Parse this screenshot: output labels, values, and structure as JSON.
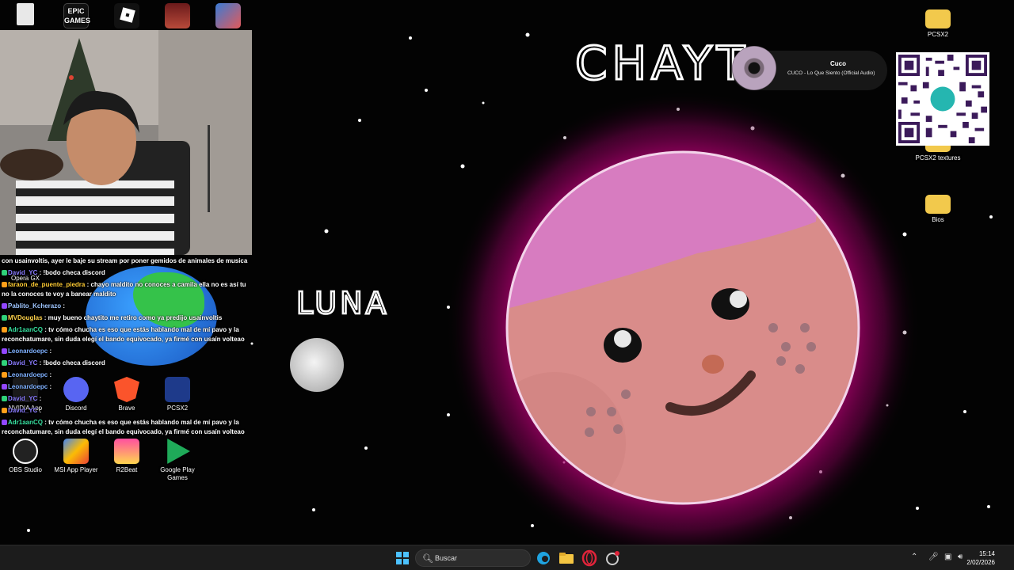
{
  "wallpaper": {
    "title_text": "CHAYT",
    "luna_text": "LUNA"
  },
  "desktop": {
    "top_icons": [
      {
        "name": "recycle-bin-icon",
        "label": ""
      },
      {
        "name": "epic-games-icon",
        "label": "EPIC GAMES"
      },
      {
        "name": "roblox-icon",
        "label": ""
      },
      {
        "name": "game-shortcut-1-icon",
        "label": ""
      },
      {
        "name": "game-shortcut-2-icon",
        "label": ""
      }
    ],
    "right_icons": [
      {
        "name": "folder-pcsx2",
        "label": "PCSX2"
      },
      {
        "name": "folder-pcsx2-textures",
        "label": "PCSX2 textures"
      },
      {
        "name": "folder-bios",
        "label": "Bios"
      }
    ],
    "left_icons_row1": [
      {
        "label": "Discord"
      },
      {
        "label": "Brave"
      },
      {
        "label": "PCSX2"
      }
    ],
    "left_icons_row2": [
      {
        "label": "OBS Studio"
      },
      {
        "label": "MSI App Player"
      },
      {
        "label": "R2Beat"
      },
      {
        "label": "Google Play Games"
      }
    ],
    "partial_labels": {
      "opera_gx": "Opera GX",
      "nvidia_app": "NVIDIA App"
    }
  },
  "chat": {
    "lines": [
      {
        "user": "",
        "user_color": "#ffffff",
        "text": "con usainvoltis, ayer le baje su stream por poner gemidos de animales de musica"
      },
      {
        "user": "David_YC",
        "user_color": "#8a7cff",
        "text": ": !bodo checa discord"
      },
      {
        "user": "faraon_de_puente_piedra",
        "user_color": "#ffcc33",
        "text": ": chayo maldito no conoces a camila ella no es así tu no la conoces te voy a banear maldito"
      },
      {
        "user": "Pablito_Kcherazo",
        "user_color": "#9fc6ff",
        "text": ":"
      },
      {
        "user": "MVDouglas",
        "user_color": "#ffd24a",
        "text": ": muy bueno chaytito me retiro como ya predijo usainvoltis"
      },
      {
        "user": "Adr1aanCQ",
        "user_color": "#37e0a0",
        "text": ": tv cómo chucha es eso que estás hablando mal de mí pavo y la reconchatumare, sin duda elegí el bando equivocado, ya firmé con usaín volteao"
      },
      {
        "user": "Leonardoepc",
        "user_color": "#7fb1ff",
        "text": ":"
      },
      {
        "user": "David_YC",
        "user_color": "#8a7cff",
        "text": ": !bodo checa discord"
      },
      {
        "user": "Leonardoepc",
        "user_color": "#7fb1ff",
        "text": ":"
      },
      {
        "user": "Leonardoepc",
        "user_color": "#7fb1ff",
        "text": ":"
      },
      {
        "user": "David_YC",
        "user_color": "#8a7cff",
        "text": ":"
      },
      {
        "user": "David_YC",
        "user_color": "#8a7cff",
        "text": ":"
      },
      {
        "user": "Adr1aanCQ",
        "user_color": "#37e0a0",
        "text": ": tv cómo chucha es eso que estás hablando mal de mí pavo y la reconchatumare, sin duda elegí el bando equivocado, ya firmé con usaín volteao"
      }
    ]
  },
  "music": {
    "artist": "Cuco",
    "track": "CUCO - Lo Que Siento (Official Audio)"
  },
  "taskbar": {
    "search_placeholder": "Buscar",
    "time": "15:14",
    "date": "2/02/2026"
  },
  "colors": {
    "planet_pink": "#d98c8a",
    "planet_cap": "#d77cc0",
    "glow": "#c0007a",
    "taskbar": "#1c1c1c"
  }
}
